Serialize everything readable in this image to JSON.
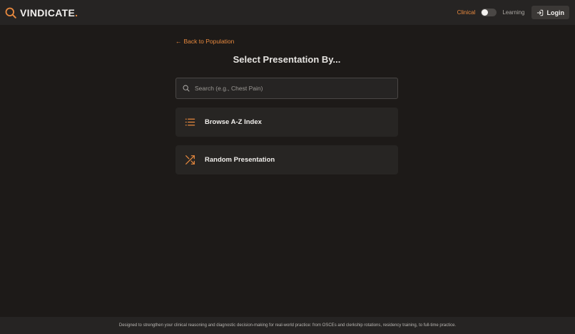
{
  "header": {
    "brand_name": "VINDICATE",
    "brand_dot": ".",
    "mode_clinical": "Clinical",
    "mode_learning": "Learning",
    "login_label": "Login"
  },
  "main": {
    "back_link": "Back to Population",
    "back_arrow": "←",
    "title": "Select Presentation By...",
    "search_placeholder": "Search (e.g., Chest Pain)",
    "search_value": "",
    "options": [
      {
        "label": "Browse A-Z Index",
        "icon": "list-icon"
      },
      {
        "label": "Random Presentation",
        "icon": "shuffle-icon"
      }
    ]
  },
  "footer": {
    "text": "Designed to strengthen your clinical reasoning and diagnostic decision-making for real-world practice: from OSCEs and clerkship rotations, residency training, to full-time practice."
  },
  "colors": {
    "accent": "#e8893e",
    "background": "#1d1a18",
    "surface": "#262423"
  }
}
